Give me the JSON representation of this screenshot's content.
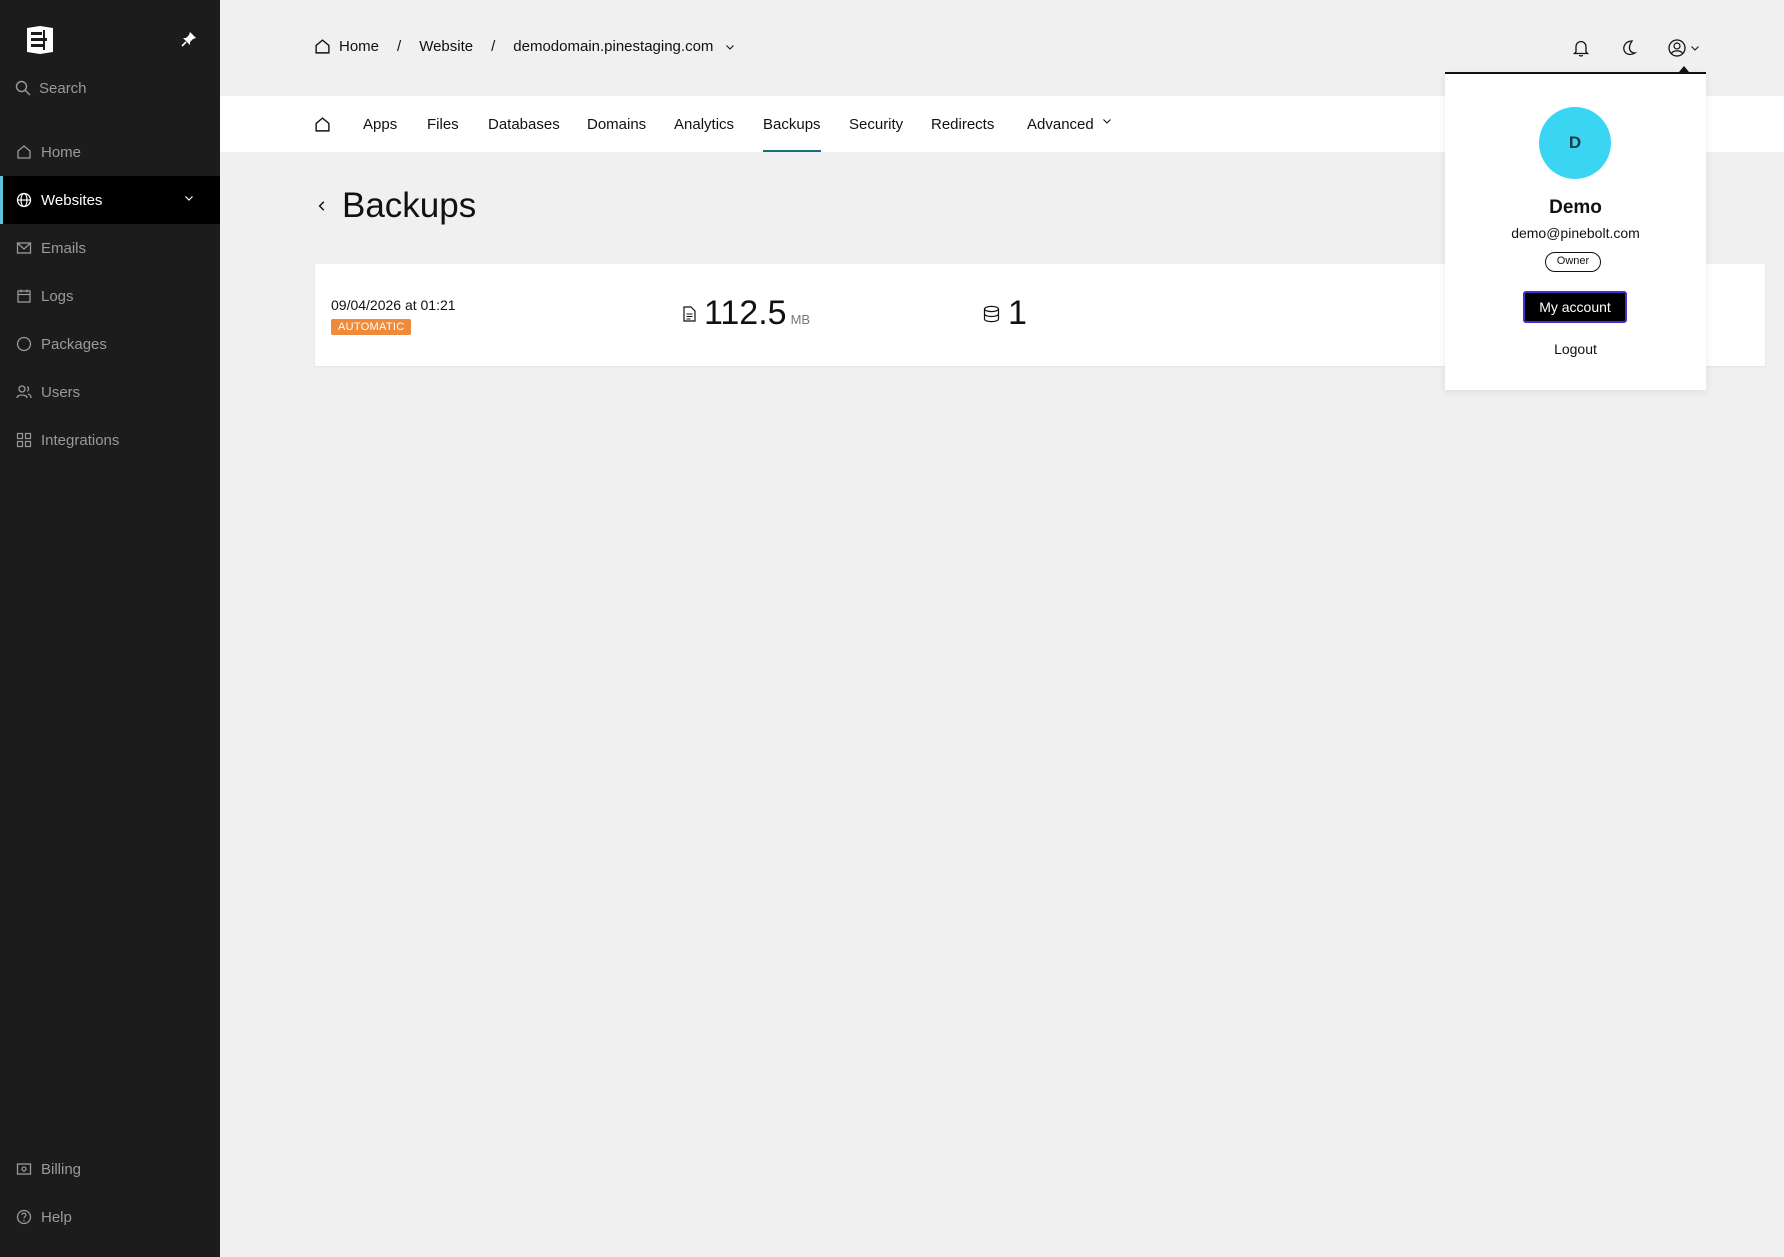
{
  "sidebar": {
    "search_label": "Search",
    "items": [
      {
        "label": "Home"
      },
      {
        "label": "Websites"
      },
      {
        "label": "Emails"
      },
      {
        "label": "Logs"
      },
      {
        "label": "Packages"
      },
      {
        "label": "Users"
      },
      {
        "label": "Integrations"
      }
    ],
    "bottom": [
      {
        "label": "Billing"
      },
      {
        "label": "Help"
      }
    ]
  },
  "breadcrumb": {
    "home": "Home",
    "website": "Website",
    "domain": "demodomain.pinestaging.com",
    "separator": "/"
  },
  "tabs": [
    {
      "label": "Apps"
    },
    {
      "label": "Files"
    },
    {
      "label": "Databases"
    },
    {
      "label": "Domains"
    },
    {
      "label": "Analytics"
    },
    {
      "label": "Backups"
    },
    {
      "label": "Security"
    },
    {
      "label": "Redirects"
    },
    {
      "label": "Advanced"
    }
  ],
  "page": {
    "title": "Backups"
  },
  "backup": {
    "date": "09/04/2026 at 01:21",
    "type": "AUTOMATIC",
    "size": "112.5",
    "size_unit": "MB",
    "databases": "1"
  },
  "user_menu": {
    "initial": "D",
    "name": "Demo",
    "email": "demo@pinebolt.com",
    "role": "Owner",
    "account_label": "My account",
    "logout_label": "Logout"
  },
  "colors": {
    "sidebar_bg": "#1c1c1c",
    "active_accent": "#5ec3d6",
    "tab_underline": "#1a6d7a",
    "badge": "#ef8a3a",
    "avatar": "#3ad5f2"
  }
}
